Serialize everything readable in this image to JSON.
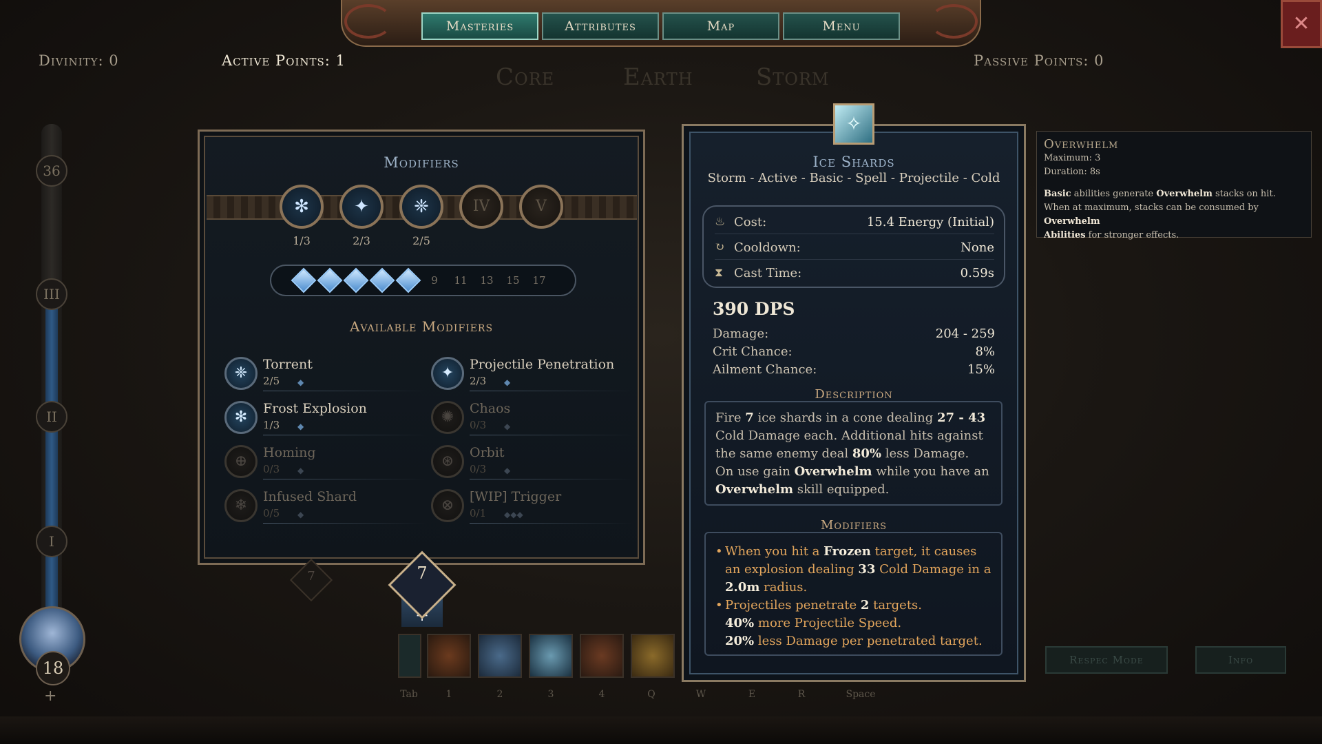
{
  "nav": {
    "tabs": [
      {
        "label": "Masteries",
        "active": true
      },
      {
        "label": "Attributes",
        "active": false
      },
      {
        "label": "Map",
        "active": false
      },
      {
        "label": "Menu",
        "active": false
      }
    ]
  },
  "stats": {
    "divinity": "Divinity: 0",
    "active_points": "Active Points: 1",
    "passive_points": "Passive Points: 0"
  },
  "tree_tabs": [
    "Core",
    "Earth",
    "Storm"
  ],
  "level_column": {
    "tiers": [
      "36",
      "III",
      "II",
      "I"
    ],
    "level": "18",
    "plus": "+"
  },
  "modifiers_panel": {
    "title": "Modifiers",
    "slots": [
      {
        "roman": "",
        "count": "1/3",
        "locked": false,
        "icon": "frost-explosion-icon"
      },
      {
        "roman": "",
        "count": "2/3",
        "locked": false,
        "icon": "projectile-penetration-icon"
      },
      {
        "roman": "",
        "count": "2/5",
        "locked": false,
        "icon": "torrent-icon"
      },
      {
        "roman": "IV",
        "count": "",
        "locked": true,
        "icon": "locked-slot-icon"
      },
      {
        "roman": "V",
        "count": "",
        "locked": true,
        "icon": "locked-slot-icon"
      }
    ],
    "pips_filled": 5,
    "pip_labels": [
      "9",
      "11",
      "13",
      "15",
      "17"
    ],
    "available_title": "Available Modifiers",
    "available": [
      {
        "name": "Torrent",
        "count": "2/5",
        "gems": "◆",
        "active": true
      },
      {
        "name": "Projectile Penetration",
        "count": "2/3",
        "gems": "◆",
        "active": true
      },
      {
        "name": "Frost Explosion",
        "count": "1/3",
        "gems": "◆",
        "active": true
      },
      {
        "name": "Chaos",
        "count": "0/3",
        "gems": "◆",
        "active": false
      },
      {
        "name": "Homing",
        "count": "0/3",
        "gems": "◆",
        "active": false
      },
      {
        "name": "Orbit",
        "count": "0/3",
        "gems": "◆",
        "active": false
      },
      {
        "name": "Infused Shard",
        "count": "0/5",
        "gems": "◆",
        "active": false
      },
      {
        "name": "[WIP] Trigger",
        "count": "0/1",
        "gems": "◆◆◆",
        "active": false
      }
    ],
    "points_badge": "7",
    "shadow_badge": "7",
    "plus": "+"
  },
  "skill": {
    "name": "Ice Shards",
    "tags": "Storm - Active - Basic - Spell - Projectile - Cold",
    "cost_label": "Cost:",
    "cost_value": "15.4 Energy (Initial)",
    "cooldown_label": "Cooldown:",
    "cooldown_value": "None",
    "cast_label": "Cast Time:",
    "cast_value": "0.59s",
    "dps": "390 DPS",
    "damage_label": "Damage:",
    "damage_value": "204 - 259",
    "crit_label": "Crit Chance:",
    "crit_value": "8%",
    "ailment_label": "Ailment Chance:",
    "ailment_value": "15%",
    "description_title": "Description",
    "description": {
      "p1": "Fire ",
      "n1": "7",
      "p2": " ice shards in a cone dealing ",
      "n2": "27 - 43",
      "p3": " Cold Damage each. Additional hits against the same enemy deal ",
      "n3": "80%",
      "p4": " less Damage.",
      "p5": "On use gain ",
      "n4": "Overwhelm",
      "p6": " while you have an ",
      "n5": "Overwhelm",
      "p7": " skill equipped."
    },
    "modifiers_title": "Modifiers",
    "modifiers": {
      "m1a": "When you hit a ",
      "m1b": "Frozen",
      "m1c": " target, it causes an explosion dealing ",
      "m1d": "33",
      "m1e": " Cold Damage in a ",
      "m1f": "2.0m",
      "m1g": " radius.",
      "m2a": "Projectiles penetrate ",
      "m2b": "2",
      "m2c": " targets.",
      "m3a": "40%",
      "m3b": " more Projectile Speed.",
      "m4a": "20%",
      "m4b": " less Damage per penetrated target."
    }
  },
  "tooltip": {
    "title": "Overwhelm",
    "maximum": "Maximum: 3",
    "duration": "Duration: 8s",
    "l1a": "Basic",
    "l1b": " abilities generate ",
    "l1c": "Overwhelm",
    "l1d": " stacks on hit.",
    "l2a": "When at maximum, stacks can be consumed by ",
    "l2b": "Overwhelm",
    "l3a": "Abilities",
    "l3b": " for stronger effects."
  },
  "hotbar": {
    "keys": [
      "Tab",
      "1",
      "2",
      "3",
      "4",
      "Q",
      "W",
      "E",
      "R",
      "Space"
    ]
  },
  "buttons": {
    "respec": "Respec Mode",
    "info": "Info"
  },
  "colors": {
    "accent_teal": "#2f7a6e",
    "gold": "#c8a880",
    "modifier_orange": "#e2a55c",
    "frost_blue": "#9ed0ff"
  }
}
